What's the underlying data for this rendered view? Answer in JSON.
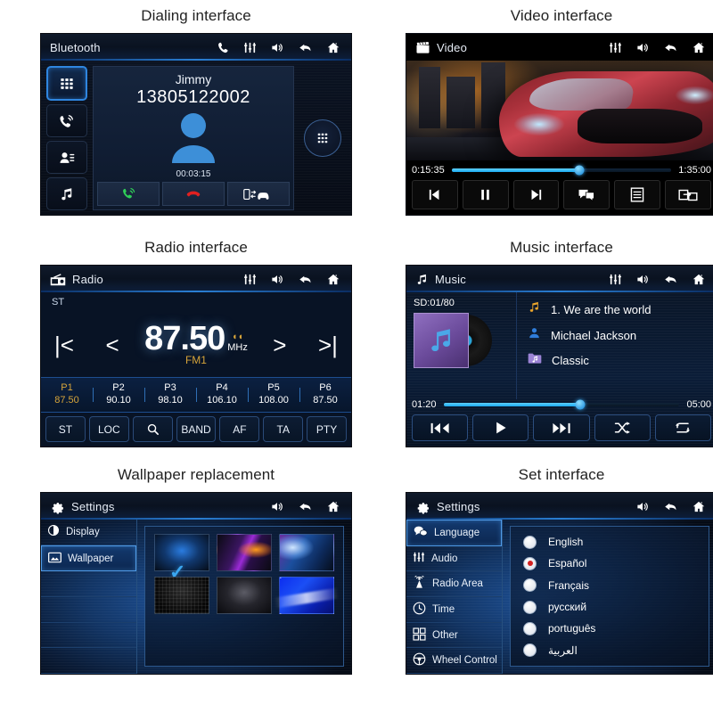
{
  "panels": {
    "dialing": {
      "caption": "Dialing interface",
      "header": {
        "title": "Bluetooth",
        "icons": [
          "phone-icon",
          "equalizer-icon",
          "volume-icon",
          "back-icon",
          "home-icon"
        ]
      },
      "rail": [
        {
          "name": "keypad-icon",
          "selected": true
        },
        {
          "name": "call-log-icon",
          "selected": false
        },
        {
          "name": "contacts-icon",
          "selected": false
        },
        {
          "name": "music-note-icon",
          "selected": false
        }
      ],
      "contact_name": "Jimmy",
      "phone_number": "13805122002",
      "call_timer": "00:03:15",
      "actions": [
        "answer-call-icon",
        "end-call-icon",
        "transfer-call-icon"
      ],
      "side_key": "dialpad-icon"
    },
    "video": {
      "caption": "Video interface",
      "header": {
        "title": "Video",
        "leading_icon": "clapperboard-icon",
        "icons": [
          "equalizer-icon",
          "volume-icon",
          "back-icon",
          "home-icon"
        ]
      },
      "elapsed": "0:15:35",
      "duration": "1:35:00",
      "progress_percent": 58,
      "buttons": [
        "previous-icon",
        "pause-icon",
        "next-icon",
        "subtitle-icon",
        "playlist-icon",
        "screen-mirror-icon"
      ]
    },
    "radio": {
      "caption": "Radio interface",
      "header": {
        "title": "Radio",
        "leading_icon": "radio-icon",
        "icons": [
          "equalizer-icon",
          "volume-icon",
          "back-icon",
          "home-icon"
        ]
      },
      "stereo_label": "ST",
      "frequency": "87.50",
      "unit": "MHz",
      "band": "FM1",
      "presets": [
        {
          "slot": "P1",
          "freq": "87.50",
          "active": true
        },
        {
          "slot": "P2",
          "freq": "90.10",
          "active": false
        },
        {
          "slot": "P3",
          "freq": "98.10",
          "active": false
        },
        {
          "slot": "P4",
          "freq": "106.10",
          "active": false
        },
        {
          "slot": "P5",
          "freq": "108.00",
          "active": false
        },
        {
          "slot": "P6",
          "freq": "87.50",
          "active": false
        }
      ],
      "buttons": [
        "ST",
        "LOC",
        "",
        "BAND",
        "AF",
        "TA",
        "PTY"
      ],
      "search_button_index": 2
    },
    "music": {
      "caption": "Music interface",
      "header": {
        "title": "Music",
        "leading_icon": "music-note-icon",
        "icons": [
          "equalizer-icon",
          "volume-icon",
          "back-icon",
          "home-icon"
        ]
      },
      "source_label": "SD:01/80",
      "track": "1. We are the world",
      "artist": "Michael Jackson",
      "album": "Classic",
      "elapsed": "01:20",
      "duration": "05:00",
      "progress_percent": 58,
      "buttons": [
        "previous-icon",
        "play-icon",
        "next-icon",
        "shuffle-icon",
        "repeat-icon"
      ]
    },
    "wallpaper": {
      "caption": "Wallpaper replacement",
      "header": {
        "title": "Settings",
        "leading_icon": "gear-icon",
        "icons": [
          "volume-icon",
          "back-icon",
          "home-icon"
        ]
      },
      "menu": [
        {
          "label": "Display",
          "icon": "contrast-icon",
          "selected": false
        },
        {
          "label": "Wallpaper",
          "icon": "image-icon",
          "selected": true
        },
        {
          "label": "",
          "icon": "",
          "selected": false
        },
        {
          "label": "",
          "icon": "",
          "selected": false
        },
        {
          "label": "",
          "icon": "",
          "selected": false
        },
        {
          "label": "",
          "icon": "",
          "selected": false
        }
      ],
      "thumbnails": [
        {
          "id": "blue-glow",
          "selected": true
        },
        {
          "id": "purple-orange-wave",
          "selected": false
        },
        {
          "id": "blue-bokeh",
          "selected": false
        },
        {
          "id": "dark-grid",
          "selected": false
        },
        {
          "id": "grey-gradient",
          "selected": false
        },
        {
          "id": "blue-swoosh",
          "selected": false
        }
      ],
      "check_mark": "✓"
    },
    "settings": {
      "caption": "Set interface",
      "header": {
        "title": "Settings",
        "leading_icon": "gear-icon",
        "icons": [
          "volume-icon",
          "back-icon",
          "home-icon"
        ]
      },
      "menu": [
        {
          "label": "Language",
          "icon": "speech-bubble-icon",
          "selected": true
        },
        {
          "label": "Audio",
          "icon": "equalizer-icon",
          "selected": false
        },
        {
          "label": "Radio Area",
          "icon": "antenna-icon",
          "selected": false
        },
        {
          "label": "Time",
          "icon": "clock-icon",
          "selected": false
        },
        {
          "label": "Other",
          "icon": "grid-blocks-icon",
          "selected": false
        },
        {
          "label": "Wheel Control",
          "icon": "steering-wheel-icon",
          "selected": false
        }
      ],
      "languages": [
        {
          "label": "English",
          "selected": false
        },
        {
          "label": "Español",
          "selected": true
        },
        {
          "label": "Français",
          "selected": false
        },
        {
          "label": "русский",
          "selected": false
        },
        {
          "label": "português",
          "selected": false
        },
        {
          "label": "العربية",
          "selected": false
        }
      ]
    }
  },
  "colors": {
    "accent_blue": "#2f86e0",
    "gold": "#d6a43a",
    "answer_green": "#28b34a",
    "end_red": "#d32020",
    "progress_cyan": "#1aa8ee"
  }
}
